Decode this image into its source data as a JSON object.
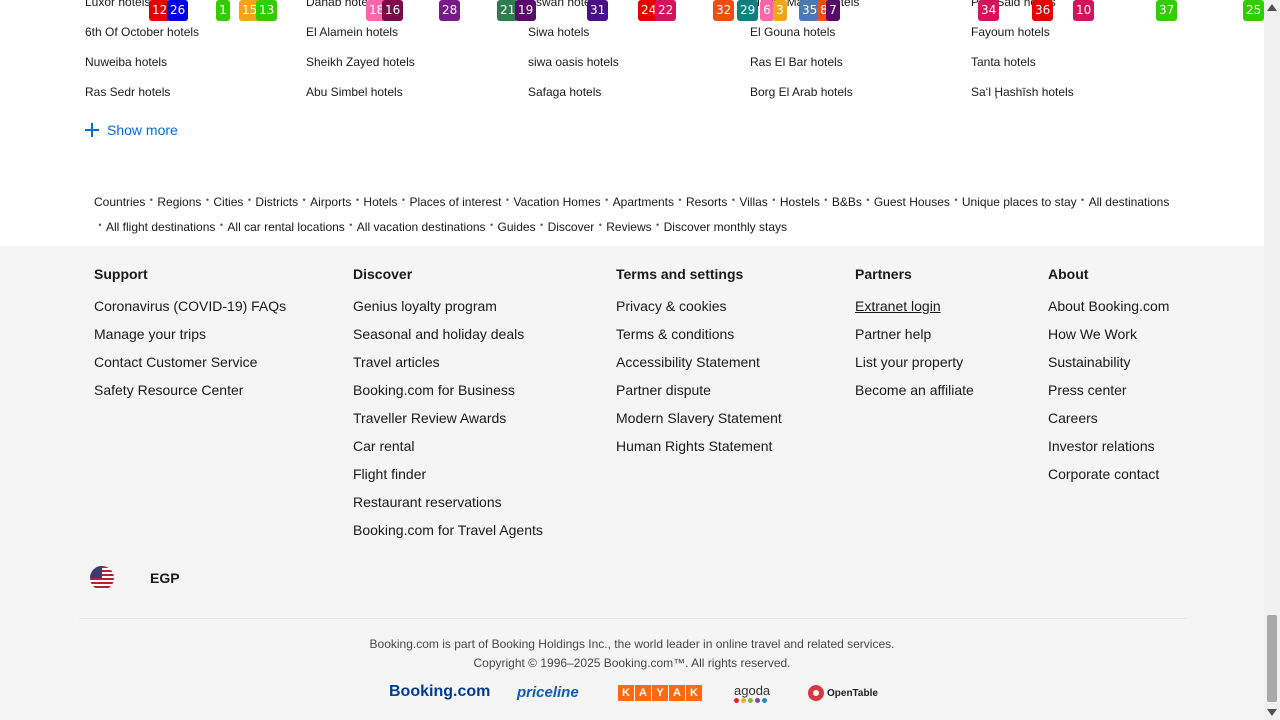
{
  "city_columns": [
    [
      "Luxor hotels",
      "6th Of October hotels",
      "Nuweiba hotels",
      "Ras Sedr hotels"
    ],
    [
      "Dahab hotels",
      "El Alamein hotels",
      "Sheikh Zayed hotels",
      "Abu Simbel hotels"
    ],
    [
      "Aswan hotels",
      "Siwa hotels",
      "siwa oasis hotels",
      "Safaga hotels"
    ],
    [
      "Marsa Matruh hotels",
      "El Gouna hotels",
      "Ras El Bar hotels",
      "Borg El Arab hotels"
    ],
    [
      "Port Said hotels",
      "Fayoum hotels",
      "Tanta hotels",
      "Sa‘l Ḩashīsh hotels"
    ]
  ],
  "overlay_badges": [
    {
      "label": "12",
      "color": "#e60000"
    },
    {
      "label": "26",
      "color": "#0000e6"
    },
    {
      "label": "1",
      "color": "#33cc00"
    },
    {
      "label": "15",
      "color": "#f2a51a"
    },
    {
      "label": "13",
      "color": "#33cc00"
    },
    {
      "label": "18",
      "color": "#ff66aa"
    },
    {
      "label": "16",
      "color": "#7a0a4a"
    },
    {
      "label": "28",
      "color": "#7a1a8a"
    },
    {
      "label": "21",
      "color": "#2e7d4f"
    },
    {
      "label": "19",
      "color": "#5a0a6a"
    },
    {
      "label": "31",
      "color": "#4b0f8a"
    },
    {
      "label": "24",
      "color": "#e60000"
    },
    {
      "label": "22",
      "color": "#d4145a"
    },
    {
      "label": "32",
      "color": "#f04e0c"
    },
    {
      "label": "29",
      "color": "#0f7f7f"
    },
    {
      "label": "6",
      "color": "#ff66aa"
    },
    {
      "label": "3",
      "color": "#f2a51a"
    },
    {
      "label": "35",
      "color": "#4a7bb0"
    },
    {
      "label": "8",
      "color": "#f04e0c"
    },
    {
      "label": "7",
      "color": "#5a0a6a"
    },
    {
      "label": "34",
      "color": "#d4145a"
    },
    {
      "label": "36",
      "color": "#e60000"
    },
    {
      "label": "10",
      "color": "#d4145a"
    },
    {
      "label": "37",
      "color": "#33cc00"
    },
    {
      "label": "25",
      "color": "#33cc00"
    }
  ],
  "show_more": "Show more",
  "destination_links": [
    "Countries",
    "Regions",
    "Cities",
    "Districts",
    "Airports",
    "Hotels",
    "Places of interest",
    "Vacation Homes",
    "Apartments",
    "Resorts",
    "Villas",
    "Hostels",
    "B&Bs",
    "Guest Houses",
    "Unique places to stay",
    "All destinations",
    "All flight destinations",
    "All car rental locations",
    "All vacation destinations",
    "Guides",
    "Discover",
    "Reviews",
    "Discover monthly stays"
  ],
  "footer": {
    "support": {
      "title": "Support",
      "links": [
        "Coronavirus (COVID-19) FAQs",
        "Manage your trips",
        "Contact Customer Service",
        "Safety Resource Center"
      ]
    },
    "discover": {
      "title": "Discover",
      "links": [
        "Genius loyalty program",
        "Seasonal and holiday deals",
        "Travel articles",
        "Booking.com for Business",
        "Traveller Review Awards",
        "Car rental",
        "Flight finder",
        "Restaurant reservations",
        "Booking.com for Travel Agents"
      ]
    },
    "terms": {
      "title": "Terms and settings",
      "links": [
        "Privacy & cookies",
        "Terms & conditions",
        "Accessibility Statement",
        "Partner dispute",
        "Modern Slavery Statement",
        "Human Rights Statement"
      ]
    },
    "partners": {
      "title": "Partners",
      "links": [
        "Extranet login",
        "Partner help",
        "List your property",
        "Become an affiliate"
      ]
    },
    "about": {
      "title": "About",
      "links": [
        "About Booking.com",
        "How We Work",
        "Sustainability",
        "Press center",
        "Careers",
        "Investor relations",
        "Corporate contact"
      ]
    }
  },
  "currency": "EGP",
  "legal_line1": "Booking.com is part of Booking Holdings Inc., the world leader in online travel and related services.",
  "legal_line2": "Copyright © 1996–2025 Booking.com™. All rights reserved.",
  "brands": {
    "booking": "Booking.com",
    "priceline": "priceline",
    "kayak": [
      "K",
      "A",
      "Y",
      "A",
      "K"
    ],
    "agoda": "agoda",
    "opentable": "OpenTable"
  },
  "colors": {
    "link_blue": "#006ce4",
    "footer_bg": "#f5f5f5"
  }
}
